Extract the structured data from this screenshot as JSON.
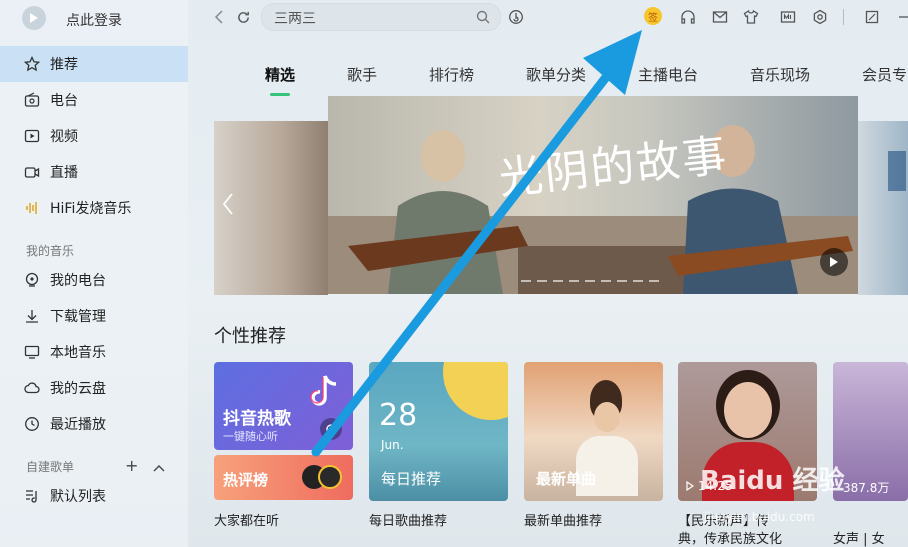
{
  "sidebar": {
    "login_label": "点此登录",
    "items": [
      {
        "label": "推荐",
        "icon": "star-icon"
      },
      {
        "label": "电台",
        "icon": "radio-icon"
      },
      {
        "label": "视频",
        "icon": "video-icon"
      },
      {
        "label": "直播",
        "icon": "live-icon"
      },
      {
        "label": "HiFi发烧音乐",
        "icon": "hifi-icon"
      }
    ],
    "my_music_title": "我的音乐",
    "my_music": [
      {
        "label": "我的电台",
        "icon": "my-radio-icon"
      },
      {
        "label": "下载管理",
        "icon": "download-icon"
      },
      {
        "label": "本地音乐",
        "icon": "local-music-icon"
      },
      {
        "label": "我的云盘",
        "icon": "cloud-icon"
      },
      {
        "label": "最近播放",
        "icon": "recent-icon"
      }
    ],
    "playlist_title": "自建歌单",
    "playlists": [
      {
        "label": "默认列表",
        "icon": "playlist-icon"
      }
    ]
  },
  "topbar": {
    "search_value": "三两三",
    "vip_badge": "签"
  },
  "tabs": [
    "精选",
    "歌手",
    "排行榜",
    "歌单分类",
    "主播电台",
    "音乐现场",
    "会员专"
  ],
  "banner": {
    "title": "光阴的故事"
  },
  "recommend": {
    "title": "个性推荐",
    "douyin": {
      "title": "抖音热歌",
      "subtitle": "一键随心听"
    },
    "hot_review": "热评榜",
    "daily": {
      "day": "28",
      "month": "Jun.",
      "label": "每日推荐"
    },
    "new_single": "最新单曲",
    "card4_time": "14:25",
    "card5_count": "387.8万",
    "captions": [
      "大家都在听",
      "每日歌曲推荐",
      "最新单曲推荐",
      "【民乐新声】传",
      "典，传承民族文化",
      "女声 | 女"
    ]
  },
  "watermark": "Baidu 经验",
  "watermark_url": "jingyan.baidu.com",
  "colors": {
    "accent": "#31c27c",
    "active_nav": "#c9e0f5",
    "arrow": "#1a9be0"
  }
}
